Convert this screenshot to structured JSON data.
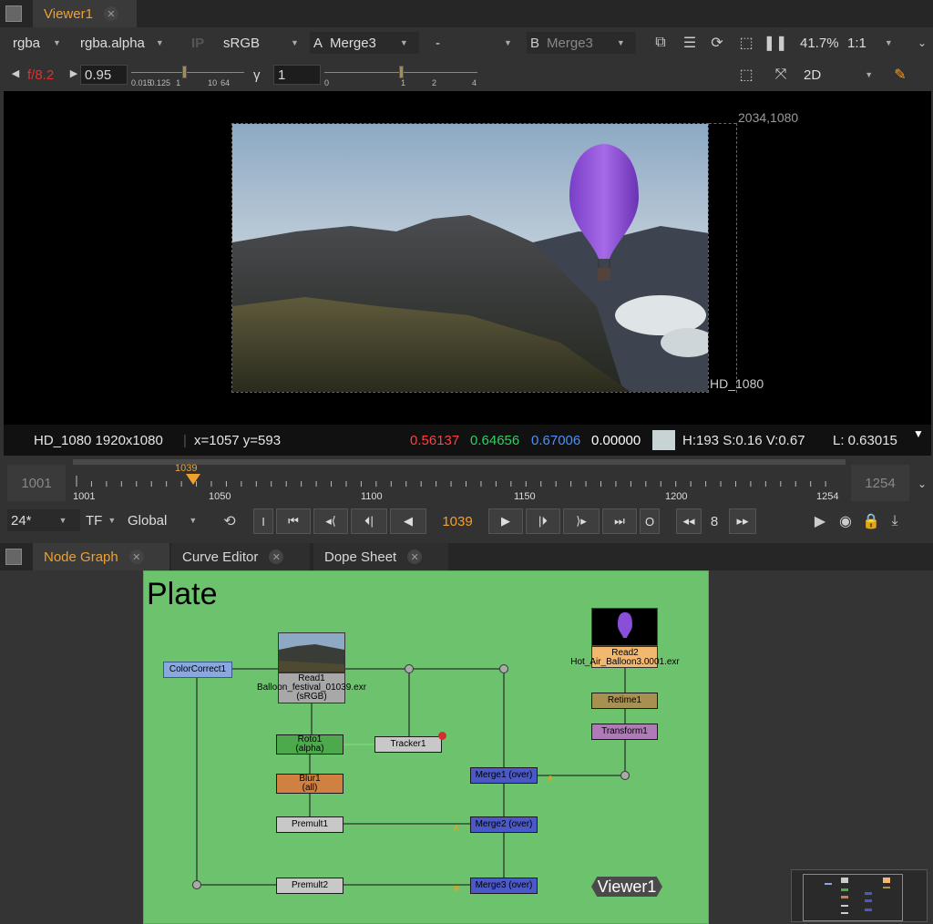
{
  "viewer_tab": {
    "title": "Viewer1"
  },
  "toolbar1": {
    "channels": "rgba",
    "alpha_channel": "rgba.alpha",
    "ip": "IP",
    "colorspace": "sRGB",
    "a_label": "A",
    "a_input": "Merge3",
    "op": "-",
    "b_label": "B",
    "b_input": "Merge3",
    "zoom": "41.7%",
    "ratio": "1:1"
  },
  "toolbar2": {
    "fstop": "f/8.2",
    "gain": "0.95",
    "gain_ticks": [
      "0.015",
      "0.125",
      "1",
      "10",
      "64"
    ],
    "gamma_label": "γ",
    "gamma": "1",
    "gamma_ticks": [
      "0",
      "1",
      "2",
      "4"
    ],
    "view_mode": "2D"
  },
  "viewer": {
    "corner_label": "2034,1080",
    "format_label": "HD_1080"
  },
  "status": {
    "format": "HD_1080 1920x1080",
    "coords": "x=1057 y=593",
    "r": "0.56137",
    "g": "0.64656",
    "b": "0.67006",
    "a": "0.00000",
    "hsv": "H:193 S:0.16 V:0.67",
    "l": "L: 0.63015",
    "swatch_color": "#c8d3d6"
  },
  "timeline": {
    "start": "1001",
    "end": "1254",
    "current": "1039",
    "ticks": [
      "1001",
      "1050",
      "1100",
      "1150",
      "1200",
      "1254"
    ]
  },
  "playback": {
    "fps": "24*",
    "tf": "TF",
    "global": "Global",
    "frame": "1039",
    "step": "8"
  },
  "graph_tabs": [
    {
      "label": "Node Graph"
    },
    {
      "label": "Curve Editor"
    },
    {
      "label": "Dope Sheet"
    }
  ],
  "graph": {
    "backdrop_title": "Plate",
    "viewer_node": "Viewer1",
    "nodes": {
      "colorcorrect": "ColorCorrect1",
      "read1": "Read1",
      "read1_file": "Balloon_festival_01039.exr",
      "read1_cs": "(sRGB)",
      "roto": "Roto1",
      "roto_sub": "(alpha)",
      "blur": "Blur1",
      "blur_sub": "(all)",
      "premult1": "Premult1",
      "premult2": "Premult2",
      "tracker": "Tracker1",
      "merge1": "Merge1 (over)",
      "merge2": "Merge2 (over)",
      "merge3": "Merge3 (over)",
      "read2": "Read2",
      "read2_file": "Hot_Air_Balloon3.0001.exr",
      "retime": "Retime1",
      "transform": "Transform1"
    }
  }
}
